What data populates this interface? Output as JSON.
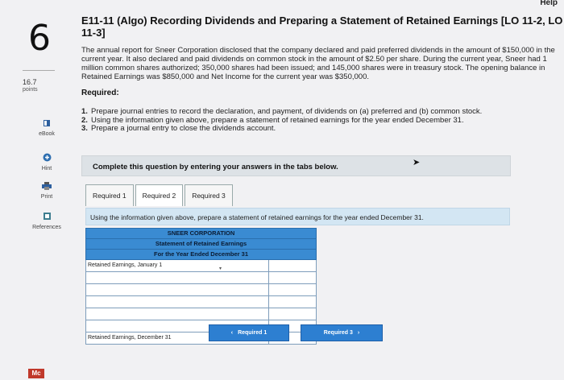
{
  "header": {
    "help": "Help"
  },
  "question": {
    "number": "6",
    "points_value": "16.7",
    "points_label": "points",
    "title": "E11-11 (Algo) Recording Dividends and Preparing a Statement of Retained Earnings [LO 11-2, LO 11-3]",
    "paragraph": "The annual report for Sneer Corporation disclosed that the company declared and paid preferred dividends in the amount of $150,000 in the current year. It also declared and paid dividends on common stock in the amount of $2.50 per share. During the current year, Sneer had 1 million common shares authorized; 350,000 shares had been issued; and 145,000 shares were in treasury stock. The opening balance in Retained Earnings was $850,000 and Net Income for the current year was $350,000.",
    "required_heading": "Required:",
    "requirements": [
      {
        "num": "1.",
        "text": "Prepare journal entries to record the declaration, and payment, of dividends on (a) preferred and (b) common stock."
      },
      {
        "num": "2.",
        "text": "Using the information given above, prepare a statement of retained earnings for the year ended December 31."
      },
      {
        "num": "3.",
        "text": "Prepare a journal entry to close the dividends account."
      }
    ]
  },
  "sidebar": {
    "tools": [
      {
        "label": "eBook",
        "icon": "book-icon"
      },
      {
        "label": "Hint",
        "icon": "hint-icon"
      },
      {
        "label": "Print",
        "icon": "print-icon"
      },
      {
        "label": "References",
        "icon": "references-icon"
      }
    ]
  },
  "banner": "Complete this question by entering your answers in the tabs below.",
  "tabs": [
    {
      "label": "Required 1",
      "active": false
    },
    {
      "label": "Required 2",
      "active": true
    },
    {
      "label": "Required 3",
      "active": false
    }
  ],
  "instruction": "Using the information given above, prepare a statement of retained earnings for the year ended December 31.",
  "statement": {
    "company": "SNEER CORPORATION",
    "name": "Statement of Retained Earnings",
    "period": "For the Year Ended December 31",
    "first_row": "Retained Earnings, January 1",
    "last_row": "Retained Earnings, December 31"
  },
  "nav": {
    "prev": "Required 1",
    "next": "Required 3"
  },
  "footer": {
    "logo": "Mc"
  },
  "colors": {
    "accent": "#2d7fd1",
    "header_blue": "#3a8bd2",
    "banner_bg": "#dde2e6"
  }
}
